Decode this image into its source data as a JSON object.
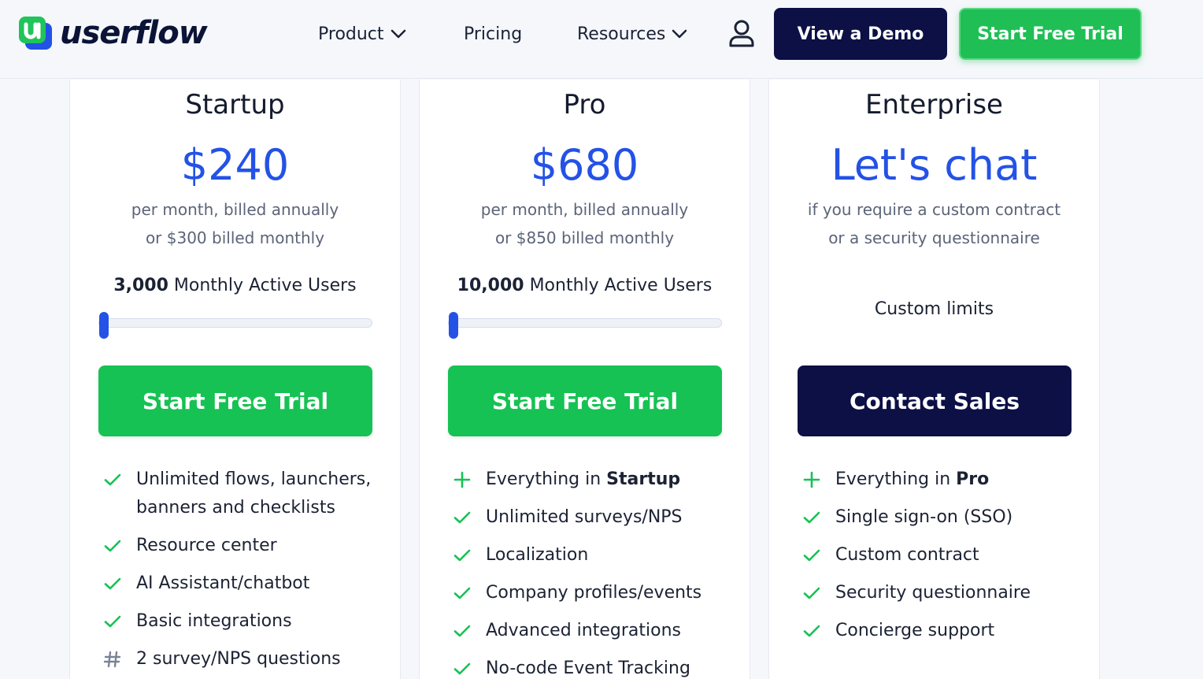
{
  "header": {
    "logo_text": "userflow",
    "nav": [
      {
        "label": "Product",
        "has_dropdown": true
      },
      {
        "label": "Pricing",
        "has_dropdown": false
      },
      {
        "label": "Resources",
        "has_dropdown": true
      }
    ],
    "demo_label": "View a Demo",
    "trial_label": "Start Free Trial",
    "icons": {
      "user": "user-icon",
      "chevron": "chevron-down-icon"
    }
  },
  "colors": {
    "accent_blue": "#2452e6",
    "green": "#16c253",
    "navy": "#0c1045"
  },
  "plans": [
    {
      "name": "Startup",
      "price": "$240",
      "sub1": "per month, billed annually",
      "sub2": "or $300 billed monthly",
      "mau_count": "3,000",
      "mau_label": " Monthly Active Users",
      "slider_level": 0,
      "cta": "Start Free Trial",
      "features": [
        {
          "icon": "check-icon",
          "text": "Unlimited flows, launchers, banners and checklists"
        },
        {
          "icon": "check-icon",
          "text": "Resource center"
        },
        {
          "icon": "check-icon",
          "text": "AI Assistant/chatbot"
        },
        {
          "icon": "check-icon",
          "text": "Basic integrations"
        },
        {
          "icon": "hash-icon",
          "text": "2 survey/NPS questions"
        }
      ]
    },
    {
      "name": "Pro",
      "price": "$680",
      "sub1": "per month, billed annually",
      "sub2": "or $850 billed monthly",
      "mau_count": "10,000",
      "mau_label": " Monthly Active Users",
      "slider_level": 0,
      "cta": "Start Free Trial",
      "features": [
        {
          "icon": "plus-icon",
          "prefix": "Everything in ",
          "bold": "Startup"
        },
        {
          "icon": "check-icon",
          "text": "Unlimited surveys/NPS"
        },
        {
          "icon": "check-icon",
          "text": "Localization"
        },
        {
          "icon": "check-icon",
          "text": "Company profiles/events"
        },
        {
          "icon": "check-icon",
          "text": "Advanced integrations"
        },
        {
          "icon": "check-icon",
          "text": "No-code Event Tracking"
        }
      ]
    },
    {
      "name": "Enterprise",
      "price": "Let's chat",
      "sub1": "if you require a custom contract",
      "sub2": "or a security questionnaire",
      "limits": "Custom limits",
      "cta": "Contact Sales",
      "features": [
        {
          "icon": "plus-icon",
          "prefix": "Everything in ",
          "bold": "Pro"
        },
        {
          "icon": "check-icon",
          "text": "Single sign-on (SSO)"
        },
        {
          "icon": "check-icon",
          "text": "Custom contract"
        },
        {
          "icon": "check-icon",
          "text": "Security questionnaire"
        },
        {
          "icon": "check-icon",
          "text": "Concierge support"
        }
      ]
    }
  ]
}
